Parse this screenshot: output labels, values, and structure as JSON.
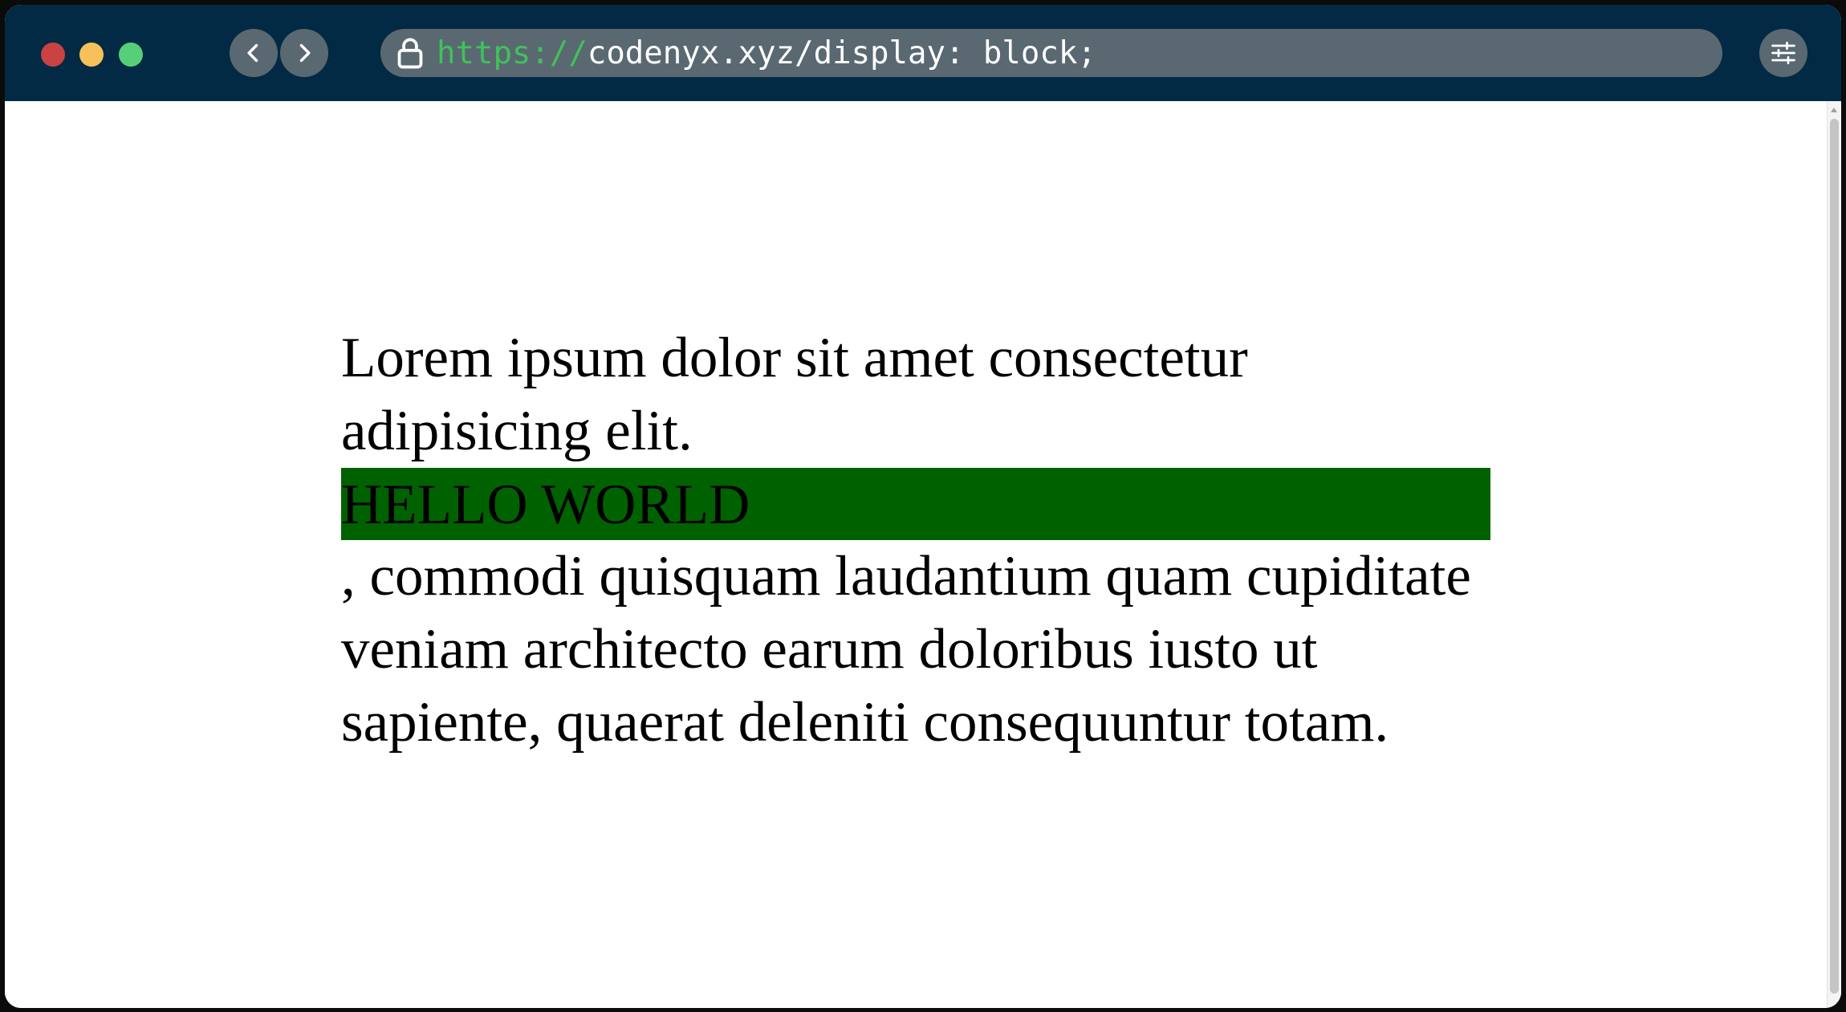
{
  "window": {
    "traffic_lights": {
      "close_color": "#c94343",
      "minimize_color": "#f6c15a",
      "zoom_color": "#57cf79"
    }
  },
  "toolbar": {
    "back_icon": "chevron-left-icon",
    "forward_icon": "chevron-right-icon",
    "settings_icon": "sliders-icon"
  },
  "address_bar": {
    "lock_icon": "lock-icon",
    "scheme": "https://",
    "path": "codenyx.xyz/display: block;",
    "scheme_color": "#3fc25a"
  },
  "page": {
    "intro_text": "Lorem ipsum dolor sit amet consectetur adipisicing elit.",
    "highlight_text": "HELLO WORLD",
    "highlight_bg": "#006100",
    "trailing_text": ", commodi quisquam laudantium quam cupiditate veniam architecto earum doloribus iusto ut sapiente, quaerat deleniti consequuntur totam."
  }
}
